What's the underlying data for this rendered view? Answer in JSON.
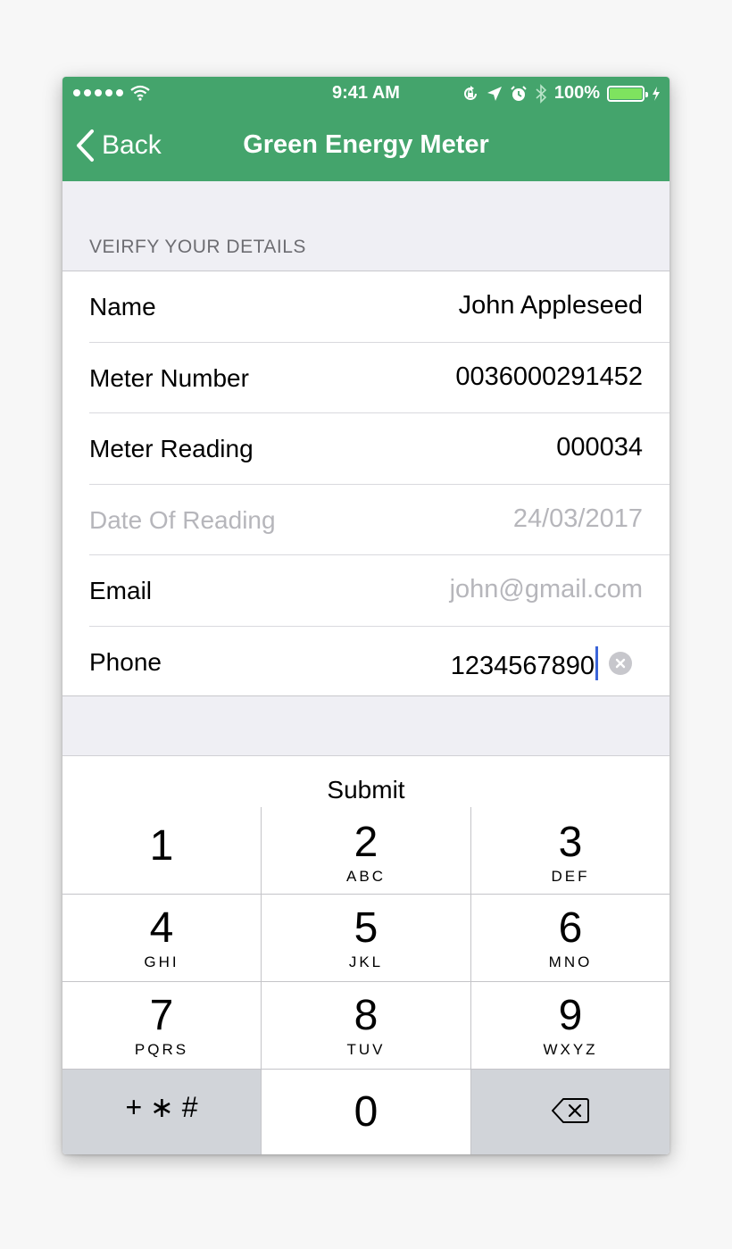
{
  "status_bar": {
    "time": "9:41 AM",
    "battery": "100%",
    "signal_dots": 5,
    "icons": [
      "wifi-icon",
      "rotation-lock-icon",
      "location-icon",
      "alarm-icon",
      "bluetooth-icon",
      "charging-icon"
    ]
  },
  "nav": {
    "back_label": "Back",
    "title": "Green Energy Meter"
  },
  "section": {
    "header": "VEIRFY YOUR DETAILS"
  },
  "rows": [
    {
      "label": "Name",
      "value": "John Appleseed"
    },
    {
      "label": "Meter Number",
      "value": "0036000291452"
    },
    {
      "label": "Meter Reading",
      "value": "000034"
    },
    {
      "label": "Date Of Reading",
      "value": "24/03/2017"
    },
    {
      "label": "Email",
      "placeholder": "john@gmail.com"
    },
    {
      "label": "Phone",
      "value": "1234567890"
    }
  ],
  "keyboard": {
    "accessory": "Submit",
    "keys": [
      {
        "num": "1",
        "letters": ""
      },
      {
        "num": "2",
        "letters": "ABC"
      },
      {
        "num": "3",
        "letters": "DEF"
      },
      {
        "num": "4",
        "letters": "GHI"
      },
      {
        "num": "5",
        "letters": "JKL"
      },
      {
        "num": "6",
        "letters": "MNO"
      },
      {
        "num": "7",
        "letters": "PQRS"
      },
      {
        "num": "8",
        "letters": "TUV"
      },
      {
        "num": "9",
        "letters": "WXYZ"
      },
      {
        "num": "+ ∗ #",
        "letters": ""
      },
      {
        "num": "0",
        "letters": ""
      }
    ]
  },
  "colors": {
    "nav_green": "#44a46c",
    "caret_blue": "#3a64d8",
    "placeholder_gray": "#b6b6bb"
  }
}
